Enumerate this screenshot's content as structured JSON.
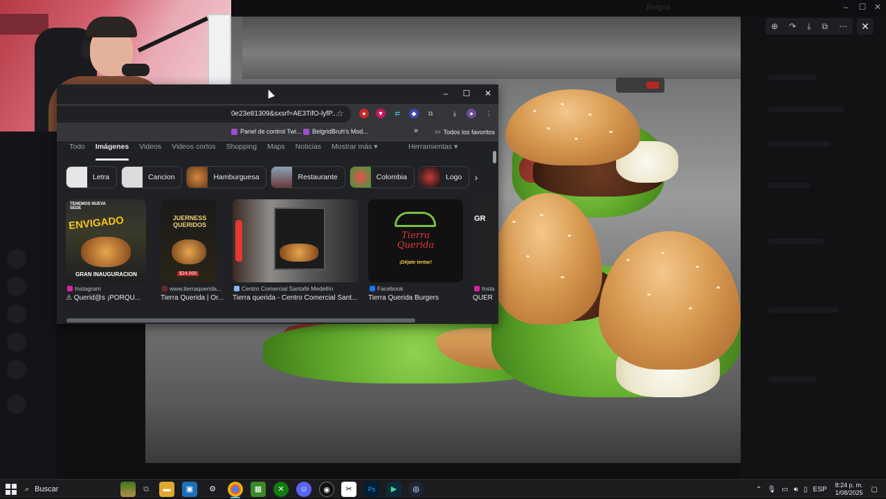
{
  "viewer": {
    "title": "Belgrid",
    "tools": [
      "zoom-in-icon",
      "rotate-icon",
      "download-icon",
      "open-external-icon",
      "more-icon"
    ],
    "close_label": "✕"
  },
  "browser": {
    "url": "0e23e81309&sxsrf=AE3TifO-lyfP...",
    "bookmarks": {
      "b1": "Panel de control Twi...",
      "b2": "BelgridBruh's Mod...",
      "more": "»",
      "all": "Todos los favoritos"
    },
    "tabs": [
      "Todo",
      "Imágenes",
      "Videos",
      "Videos cortos",
      "Shopping",
      "Maps",
      "Noticias",
      "Mostrar más ▾"
    ],
    "tools_label": "Herramientas ▾",
    "chips": [
      "Letra",
      "Cancion",
      "Hamburguesa",
      "Restaurante",
      "Colombia",
      "Logo"
    ],
    "results": [
      {
        "source": "Instagram",
        "title": "⚠ Querid@s ¡PORQU...",
        "img_text": [
          "TENEMOS NUEVA SEDE",
          "ENVIGADO",
          "GRAN INAUGURACION"
        ]
      },
      {
        "source": "www.tierraquerida...",
        "title": "Tierra Querida | Or...",
        "img_text": [
          "JUERNESS QUERIDOS",
          "$24.000"
        ]
      },
      {
        "source": "Centro Comercial Santafé Medellín",
        "title": "Tierra querida - Centro Comercial Sant...",
        "img_text": []
      },
      {
        "source": "Facebook",
        "title": "Tierra Querida Burgers",
        "img_text": [
          "Tierra",
          "Querida",
          "¡Déjate tentar!"
        ]
      },
      {
        "source": "Insta",
        "title": "QUER",
        "img_text": [
          "GR"
        ]
      }
    ]
  },
  "taskbar": {
    "search_label": "Buscar",
    "language": "ESP",
    "time": "8:24 p. m.",
    "date": "1/08/2025"
  }
}
